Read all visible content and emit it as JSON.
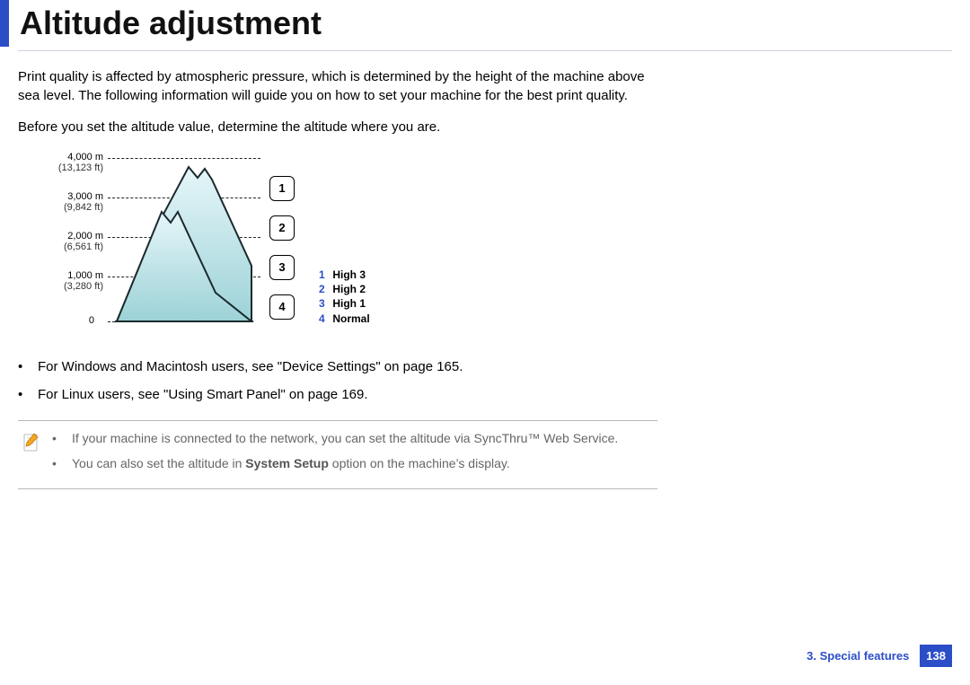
{
  "title": "Altitude adjustment",
  "intro": {
    "p1": "Print quality is affected by atmospheric pressure, which is determined by the height of the machine above sea level. The following information will guide you on how to set your machine for the best print quality.",
    "p2": "Before you set the altitude value, determine the altitude where you are."
  },
  "diagram": {
    "levels": [
      {
        "meters": "4,000 m",
        "feet": "(13,123 ft)"
      },
      {
        "meters": "3,000 m",
        "feet": "(9,842 ft)"
      },
      {
        "meters": "2,000 m",
        "feet": "(6,561 ft)"
      },
      {
        "meters": "1,000 m",
        "feet": "(3,280 ft)"
      },
      {
        "meters": "0",
        "feet": ""
      }
    ],
    "zones": [
      "1",
      "2",
      "3",
      "4"
    ],
    "legend": [
      {
        "n": "1",
        "label": "High 3"
      },
      {
        "n": "2",
        "label": "High 2"
      },
      {
        "n": "3",
        "label": "High 1"
      },
      {
        "n": "4",
        "label": "Normal"
      }
    ]
  },
  "refs": {
    "win_mac": "For Windows and Macintosh users, see \"Device Settings\" on page 165.",
    "linux": "For Linux users, see \"Using Smart Panel\" on page 169."
  },
  "note": {
    "l1a": "If your machine is connected to the network, you can set the altitude via ",
    "l1b": "SyncThru™ Web Service",
    "l1c": ".",
    "l2a": "You can also set the altitude in ",
    "l2b": "System Setup",
    "l2c": " option on the machine’s display."
  },
  "footer": {
    "section": "3.  Special features",
    "page": "138"
  }
}
